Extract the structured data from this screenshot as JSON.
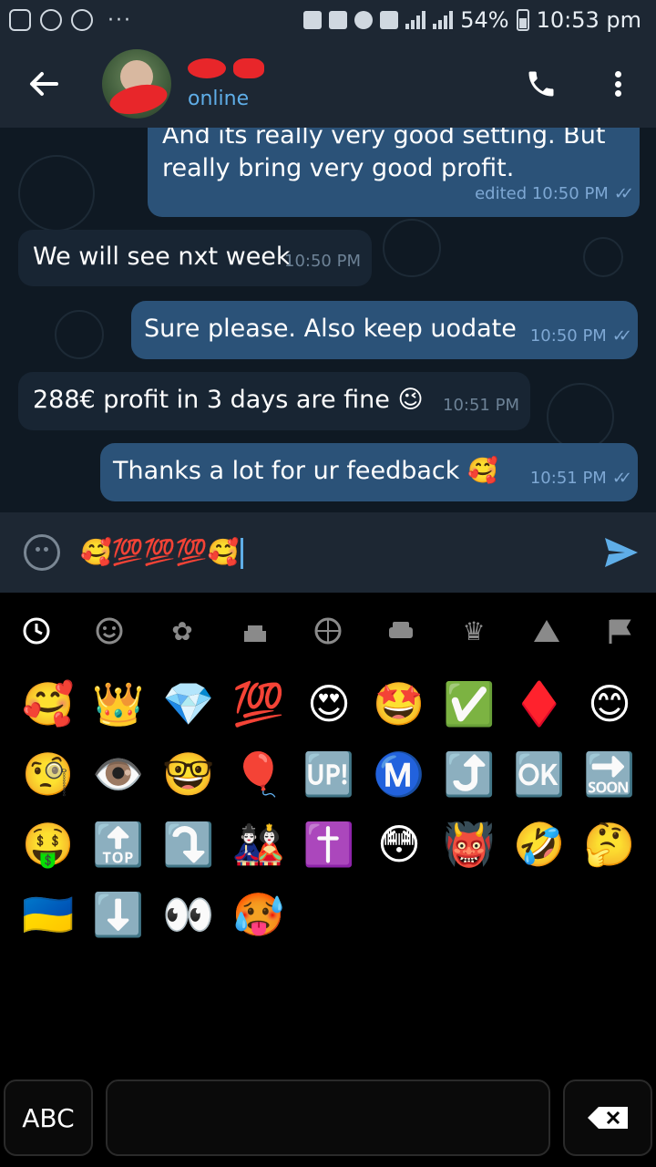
{
  "status_bar": {
    "battery": "54%",
    "time": "10:53 pm",
    "dots": "···"
  },
  "header": {
    "status": "online"
  },
  "messages": [
    {
      "direction": "out",
      "text_line1": "And its really very good setting.  But",
      "text_line2": "really bring very good profit.",
      "time": "edited 10:50 PM",
      "read": true
    },
    {
      "direction": "in",
      "text": "We will see nxt week",
      "time": "10:50 PM"
    },
    {
      "direction": "out",
      "text": "Sure please. Also keep uodate",
      "time": "10:50 PM",
      "read": true
    },
    {
      "direction": "in",
      "text": "288€ profit in 3 days are fine",
      "emoji": "😉",
      "time": "10:51 PM"
    },
    {
      "direction": "out",
      "text": "Thanks a lot for ur feedback",
      "emoji": "🥰",
      "time": "10:51 PM",
      "read": true
    }
  ],
  "input": {
    "value": "🥰💯💯💯🥰"
  },
  "keyboard": {
    "categories": [
      "recent-icon",
      "smiley-icon",
      "nature-icon",
      "food-icon",
      "sports-icon",
      "car-icon",
      "objects-icon",
      "symbols-icon",
      "flag-icon"
    ],
    "emojis": [
      "🥰",
      "👑",
      "💎",
      "💯",
      "😍",
      "🤩",
      "✅",
      "♦️",
      "😊",
      "🧐",
      "👁️",
      "🤓",
      "🎈",
      "🆙",
      "Ⓜ️",
      "⤴️",
      "🆗",
      "🔜",
      "🤑",
      "🔝",
      "⤵️",
      "🎎",
      "✝️",
      "😳",
      "👹",
      "🤣",
      "🤔",
      "🇺🇦",
      "⬇️",
      "👀",
      "🥵"
    ],
    "abc_label": "ABC"
  },
  "colors": {
    "header_bg": "#1d2733",
    "chat_bg": "#0f1923",
    "outgoing_bubble": "#2b5278",
    "incoming_bubble": "#182533",
    "accent": "#5faee8"
  }
}
